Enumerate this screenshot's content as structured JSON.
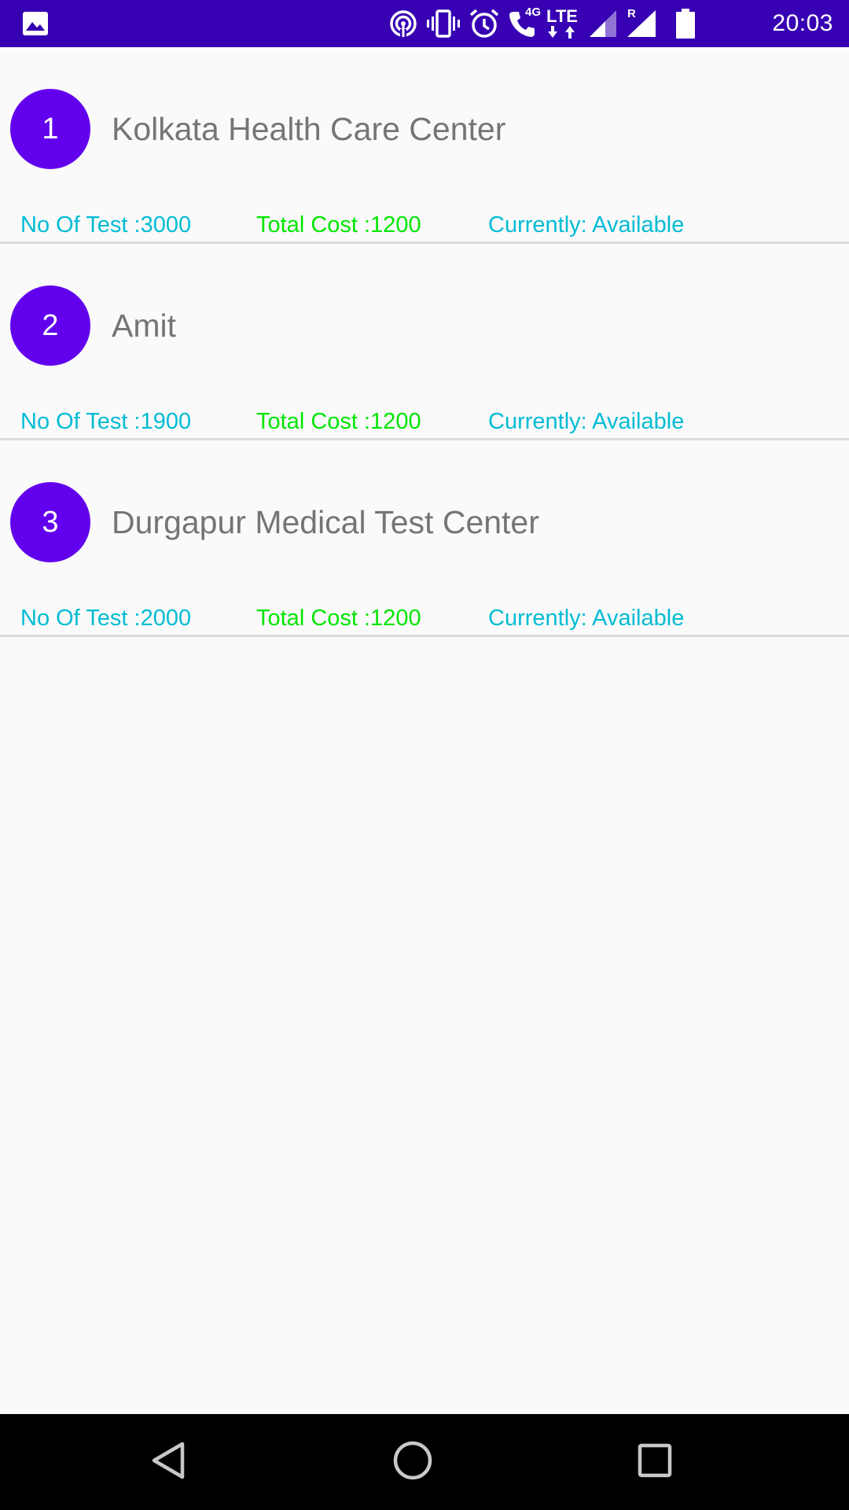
{
  "status_bar": {
    "time": "20:03",
    "icons": [
      "image-notification-icon",
      "hotspot-icon",
      "vibrate-icon",
      "alarm-icon",
      "wifi-calling-icon",
      "lte-icon",
      "signal-icon",
      "roaming-signal-icon",
      "battery-icon"
    ],
    "network_small": "4G",
    "network_label": "LTE",
    "roaming_label": "R",
    "color": "#3700b3"
  },
  "centers": [
    {
      "index": "1",
      "name": "Kolkata Health Care Center",
      "tests": "No Of Test :3000",
      "cost": "Total Cost :1200",
      "status": "Currently: Available"
    },
    {
      "index": "2",
      "name": "Amit",
      "tests": "No Of Test :1900",
      "cost": "Total Cost :1200",
      "status": "Currently: Available"
    },
    {
      "index": "3",
      "name": "Durgapur Medical Test Center",
      "tests": "No Of Test :2000",
      "cost": "Total Cost :1200",
      "status": "Currently: Available"
    }
  ],
  "colors": {
    "avatar": "#6200ee",
    "tests_text": "#00bcd4",
    "cost_text": "#00e600",
    "status_text": "#00bcd4",
    "name_text": "#757575"
  },
  "nav_bar": {
    "buttons": [
      "back-icon",
      "home-icon",
      "recents-icon"
    ]
  }
}
